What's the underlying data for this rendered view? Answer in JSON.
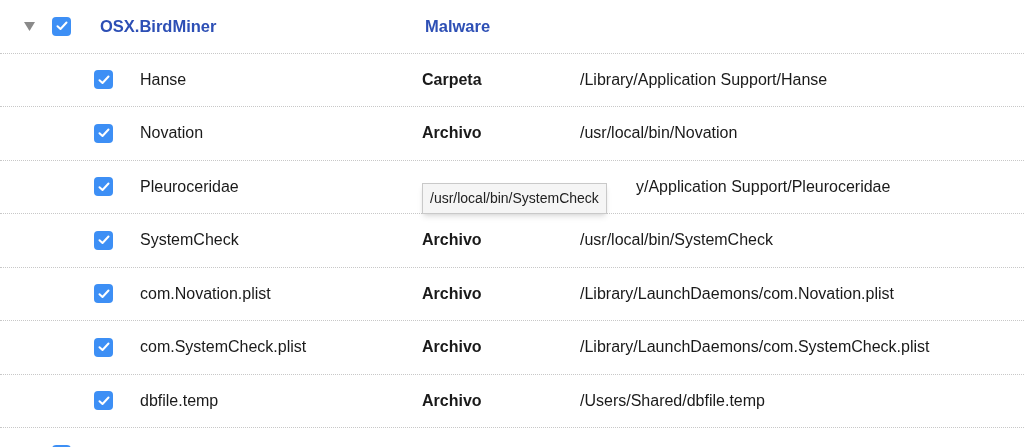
{
  "groups": [
    {
      "expanded": true,
      "checked": true,
      "name": "OSX.BirdMiner",
      "type": "Malware",
      "items": [
        {
          "checked": true,
          "name": "Hanse",
          "type": "Carpeta",
          "path": "/Library/Application Support/Hanse"
        },
        {
          "checked": true,
          "name": "Novation",
          "type": "Archivo",
          "path": "/usr/local/bin/Novation"
        },
        {
          "checked": true,
          "name": "Pleuroceridae",
          "covered_by_tooltip": true,
          "path": "y/Application Support/Pleuroceridae"
        },
        {
          "checked": true,
          "name": "SystemCheck",
          "type": "Archivo",
          "path": "/usr/local/bin/SystemCheck"
        },
        {
          "checked": true,
          "name": "com.Novation.plist",
          "type": "Archivo",
          "path": "/Library/LaunchDaemons/com.Novation.plist"
        },
        {
          "checked": true,
          "name": "com.SystemCheck.plist",
          "type": "Archivo",
          "path": "/Library/LaunchDaemons/com.SystemCheck.plist"
        },
        {
          "checked": true,
          "name": "dbfile.temp",
          "type": "Archivo",
          "path": "/Users/Shared/dbfile.temp"
        }
      ]
    },
    {
      "checked": true
    }
  ],
  "tooltip": {
    "text": "/usr/local/bin/SystemCheck"
  }
}
